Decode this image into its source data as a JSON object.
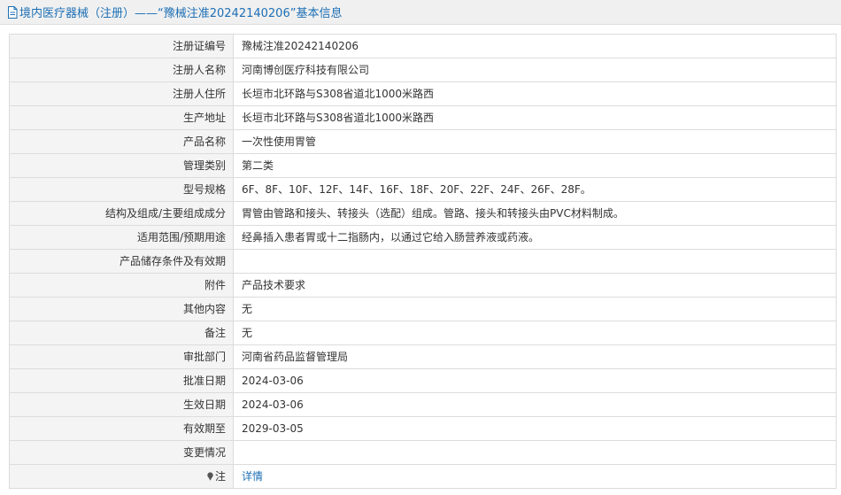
{
  "header": {
    "title": "境内医疗器械（注册）——“豫械注准20242140206”基本信息"
  },
  "rows": [
    {
      "label": "注册证编号",
      "value": "豫械注准20242140206"
    },
    {
      "label": "注册人名称",
      "value": "河南博创医疗科技有限公司"
    },
    {
      "label": "注册人住所",
      "value": "长垣市北环路与S308省道北1000米路西"
    },
    {
      "label": "生产地址",
      "value": "长垣市北环路与S308省道北1000米路西"
    },
    {
      "label": "产品名称",
      "value": "一次性使用胃管"
    },
    {
      "label": "管理类别",
      "value": "第二类"
    },
    {
      "label": "型号规格",
      "value": "6F、8F、10F、12F、14F、16F、18F、20F、22F、24F、26F、28F。"
    },
    {
      "label": "结构及组成/主要组成成分",
      "value": "胃管由管路和接头、转接头（选配）组成。管路、接头和转接头由PVC材料制成。"
    },
    {
      "label": "适用范围/预期用途",
      "value": "经鼻插入患者胃或十二指肠内，以通过它给入肠营养液或药液。"
    },
    {
      "label": "产品储存条件及有效期",
      "value": ""
    },
    {
      "label": "附件",
      "value": "产品技术要求"
    },
    {
      "label": "其他内容",
      "value": "无"
    },
    {
      "label": "备注",
      "value": "无"
    },
    {
      "label": "审批部门",
      "value": "河南省药品监督管理局"
    },
    {
      "label": "批准日期",
      "value": "2024-03-06"
    },
    {
      "label": "生效日期",
      "value": "2024-03-06"
    },
    {
      "label": "有效期至",
      "value": "2029-03-05"
    },
    {
      "label": "变更情况",
      "value": ""
    }
  ],
  "note_row": {
    "label": "注",
    "link_text": "详情",
    "icon": "pin-icon"
  },
  "colors": {
    "link": "#1c6fb5",
    "label_bg": "#f4f4f4",
    "border": "#dcdcdc"
  }
}
